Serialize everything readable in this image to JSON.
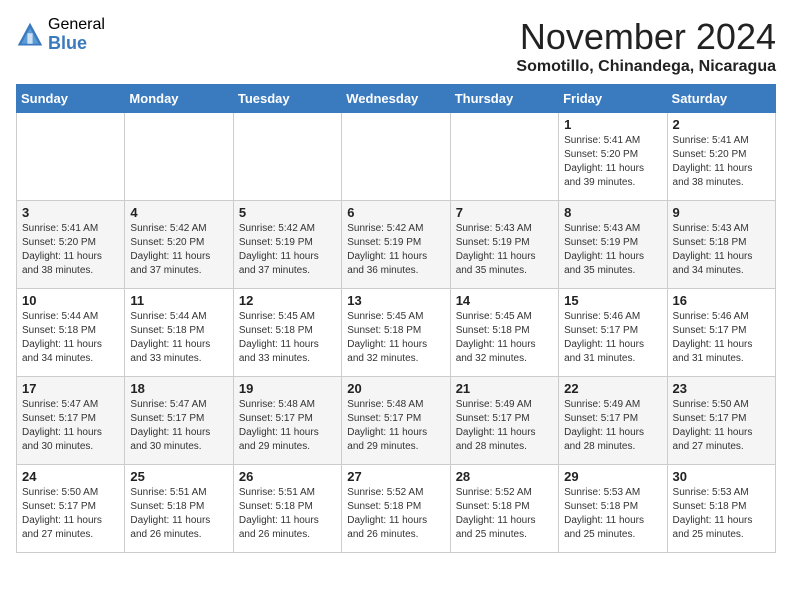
{
  "logo": {
    "general": "General",
    "blue": "Blue"
  },
  "title": "November 2024",
  "subtitle": "Somotillo, Chinandega, Nicaragua",
  "weekdays": [
    "Sunday",
    "Monday",
    "Tuesday",
    "Wednesday",
    "Thursday",
    "Friday",
    "Saturday"
  ],
  "weeks": [
    [
      {
        "day": "",
        "info": ""
      },
      {
        "day": "",
        "info": ""
      },
      {
        "day": "",
        "info": ""
      },
      {
        "day": "",
        "info": ""
      },
      {
        "day": "",
        "info": ""
      },
      {
        "day": "1",
        "info": "Sunrise: 5:41 AM\nSunset: 5:20 PM\nDaylight: 11 hours\nand 39 minutes."
      },
      {
        "day": "2",
        "info": "Sunrise: 5:41 AM\nSunset: 5:20 PM\nDaylight: 11 hours\nand 38 minutes."
      }
    ],
    [
      {
        "day": "3",
        "info": "Sunrise: 5:41 AM\nSunset: 5:20 PM\nDaylight: 11 hours\nand 38 minutes."
      },
      {
        "day": "4",
        "info": "Sunrise: 5:42 AM\nSunset: 5:20 PM\nDaylight: 11 hours\nand 37 minutes."
      },
      {
        "day": "5",
        "info": "Sunrise: 5:42 AM\nSunset: 5:19 PM\nDaylight: 11 hours\nand 37 minutes."
      },
      {
        "day": "6",
        "info": "Sunrise: 5:42 AM\nSunset: 5:19 PM\nDaylight: 11 hours\nand 36 minutes."
      },
      {
        "day": "7",
        "info": "Sunrise: 5:43 AM\nSunset: 5:19 PM\nDaylight: 11 hours\nand 35 minutes."
      },
      {
        "day": "8",
        "info": "Sunrise: 5:43 AM\nSunset: 5:19 PM\nDaylight: 11 hours\nand 35 minutes."
      },
      {
        "day": "9",
        "info": "Sunrise: 5:43 AM\nSunset: 5:18 PM\nDaylight: 11 hours\nand 34 minutes."
      }
    ],
    [
      {
        "day": "10",
        "info": "Sunrise: 5:44 AM\nSunset: 5:18 PM\nDaylight: 11 hours\nand 34 minutes."
      },
      {
        "day": "11",
        "info": "Sunrise: 5:44 AM\nSunset: 5:18 PM\nDaylight: 11 hours\nand 33 minutes."
      },
      {
        "day": "12",
        "info": "Sunrise: 5:45 AM\nSunset: 5:18 PM\nDaylight: 11 hours\nand 33 minutes."
      },
      {
        "day": "13",
        "info": "Sunrise: 5:45 AM\nSunset: 5:18 PM\nDaylight: 11 hours\nand 32 minutes."
      },
      {
        "day": "14",
        "info": "Sunrise: 5:45 AM\nSunset: 5:18 PM\nDaylight: 11 hours\nand 32 minutes."
      },
      {
        "day": "15",
        "info": "Sunrise: 5:46 AM\nSunset: 5:17 PM\nDaylight: 11 hours\nand 31 minutes."
      },
      {
        "day": "16",
        "info": "Sunrise: 5:46 AM\nSunset: 5:17 PM\nDaylight: 11 hours\nand 31 minutes."
      }
    ],
    [
      {
        "day": "17",
        "info": "Sunrise: 5:47 AM\nSunset: 5:17 PM\nDaylight: 11 hours\nand 30 minutes."
      },
      {
        "day": "18",
        "info": "Sunrise: 5:47 AM\nSunset: 5:17 PM\nDaylight: 11 hours\nand 30 minutes."
      },
      {
        "day": "19",
        "info": "Sunrise: 5:48 AM\nSunset: 5:17 PM\nDaylight: 11 hours\nand 29 minutes."
      },
      {
        "day": "20",
        "info": "Sunrise: 5:48 AM\nSunset: 5:17 PM\nDaylight: 11 hours\nand 29 minutes."
      },
      {
        "day": "21",
        "info": "Sunrise: 5:49 AM\nSunset: 5:17 PM\nDaylight: 11 hours\nand 28 minutes."
      },
      {
        "day": "22",
        "info": "Sunrise: 5:49 AM\nSunset: 5:17 PM\nDaylight: 11 hours\nand 28 minutes."
      },
      {
        "day": "23",
        "info": "Sunrise: 5:50 AM\nSunset: 5:17 PM\nDaylight: 11 hours\nand 27 minutes."
      }
    ],
    [
      {
        "day": "24",
        "info": "Sunrise: 5:50 AM\nSunset: 5:17 PM\nDaylight: 11 hours\nand 27 minutes."
      },
      {
        "day": "25",
        "info": "Sunrise: 5:51 AM\nSunset: 5:18 PM\nDaylight: 11 hours\nand 26 minutes."
      },
      {
        "day": "26",
        "info": "Sunrise: 5:51 AM\nSunset: 5:18 PM\nDaylight: 11 hours\nand 26 minutes."
      },
      {
        "day": "27",
        "info": "Sunrise: 5:52 AM\nSunset: 5:18 PM\nDaylight: 11 hours\nand 26 minutes."
      },
      {
        "day": "28",
        "info": "Sunrise: 5:52 AM\nSunset: 5:18 PM\nDaylight: 11 hours\nand 25 minutes."
      },
      {
        "day": "29",
        "info": "Sunrise: 5:53 AM\nSunset: 5:18 PM\nDaylight: 11 hours\nand 25 minutes."
      },
      {
        "day": "30",
        "info": "Sunrise: 5:53 AM\nSunset: 5:18 PM\nDaylight: 11 hours\nand 25 minutes."
      }
    ]
  ]
}
